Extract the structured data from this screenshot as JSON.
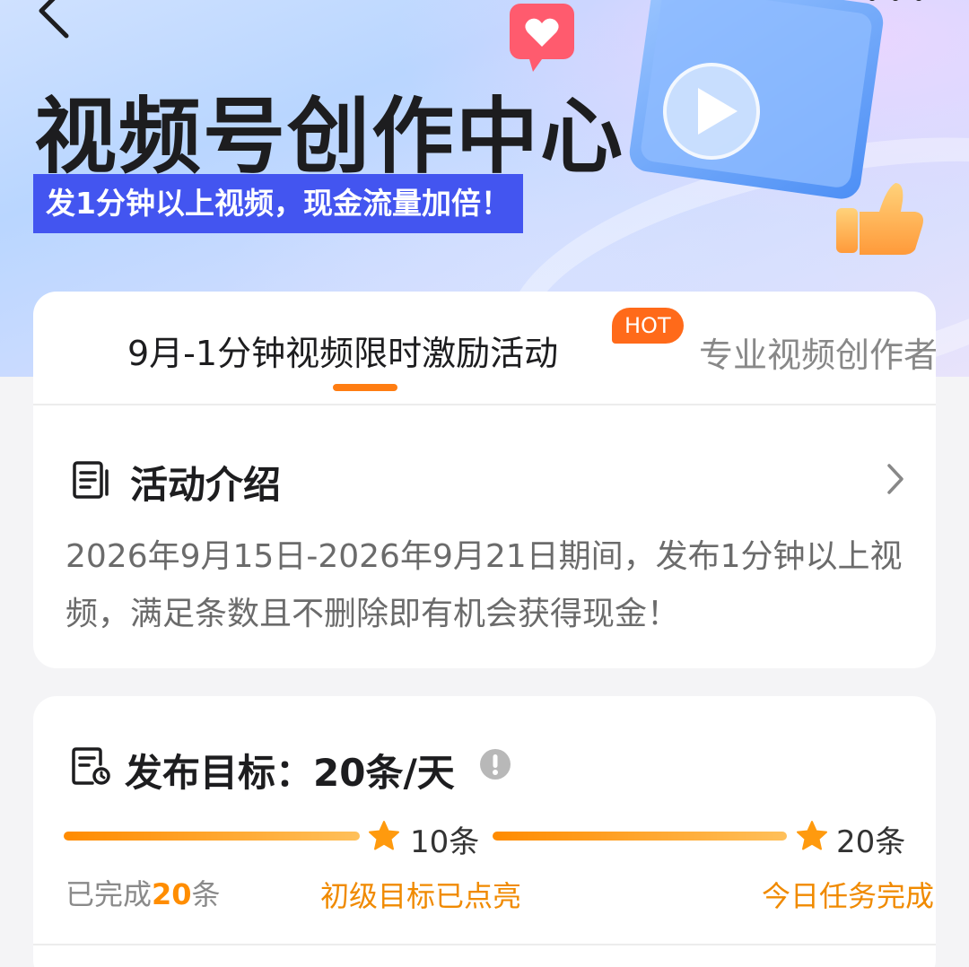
{
  "hero": {
    "title": "视频号创作中心",
    "banner": "发1分钟以上视频，现金流量加倍！"
  },
  "tabs": [
    {
      "label": "9月-1分钟视频限时激励活动",
      "active": true,
      "badge": "HOT"
    },
    {
      "label": "专业视频创作者",
      "active": false
    }
  ],
  "intro": {
    "title": "活动介绍",
    "description": "2026年9月15日-2026年9月21日期间，发布1分钟以上视频，满足条数且不删除即有机会获得现金！"
  },
  "target": {
    "title": "发布目标：20条/天",
    "milestones": [
      {
        "label": "10条",
        "status": "初级目标已点亮",
        "progress": 1.0
      },
      {
        "label": "20条",
        "status": "今日任务完成",
        "progress": 1.0
      }
    ],
    "completed_prefix": "已完成",
    "completed_count": "20",
    "completed_suffix": "条"
  },
  "colors": {
    "accent_orange": "#ff7d12",
    "banner_blue": "#4355f0",
    "hot_badge": "#ff6a1a"
  }
}
